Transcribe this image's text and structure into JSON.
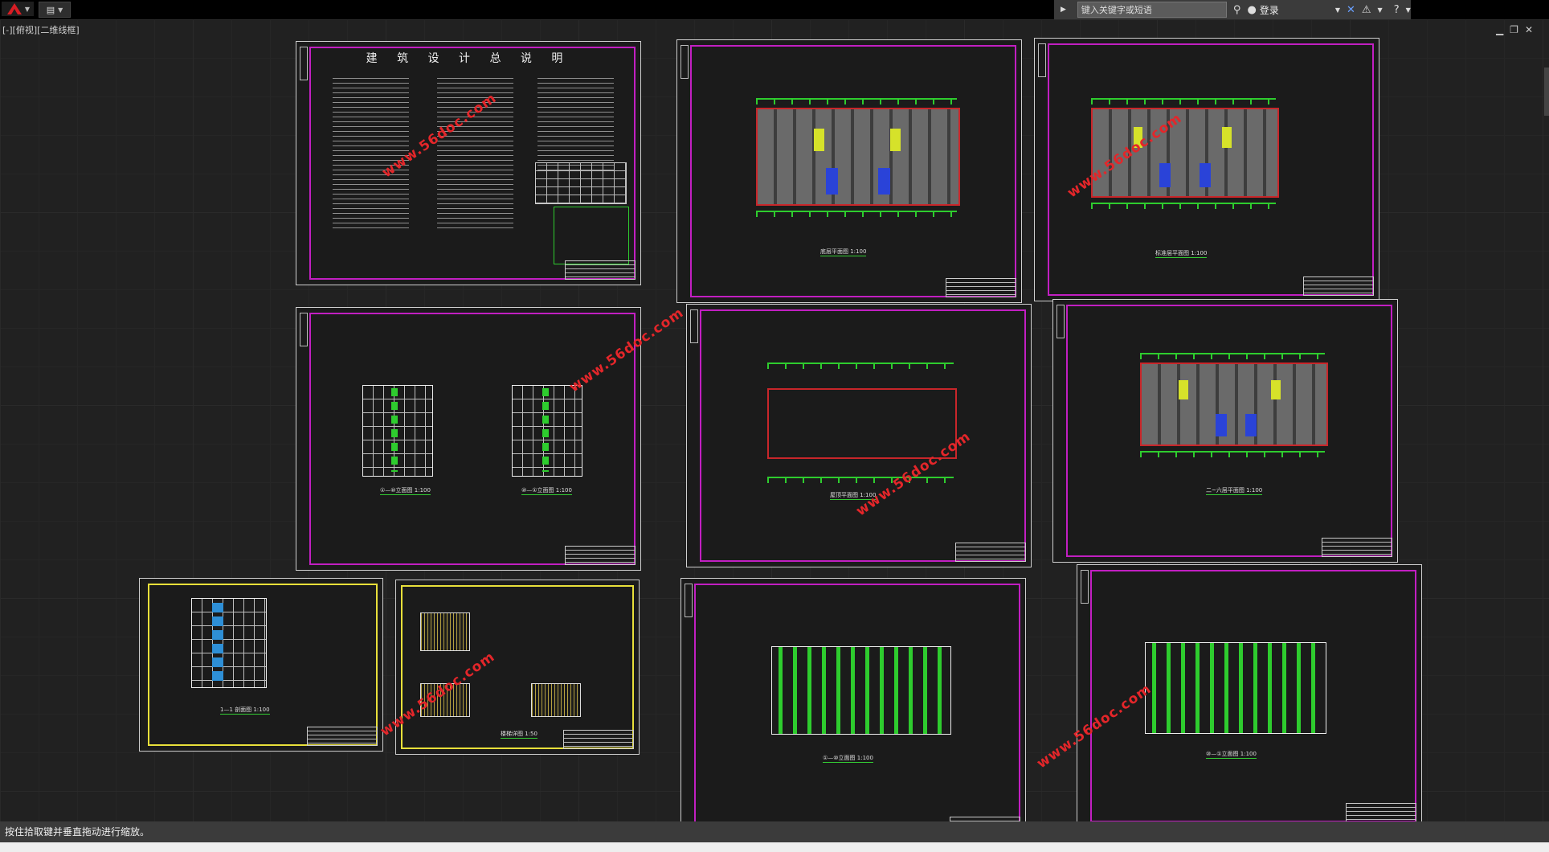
{
  "topbar": {
    "search_placeholder": "键入关键字或短语",
    "login_label": "登录"
  },
  "viewport_label": "[-][俯视][二维线框]",
  "sheets": {
    "design_notes_title": "建 筑 设 计 总 说 明",
    "plan1_caption": "底层平面图 1:100",
    "plan2_caption": "标准层平面图 1:100",
    "side_elev1_caption": "①—⑩立面图 1:100",
    "side_elev2_caption": "⑩—①立面图 1:100",
    "roof_caption": "屋顶平面图 1:100",
    "plan3_caption": "二~六层平面图 1:100",
    "section_caption": "1—1 剖面图 1:100",
    "stair_caption": "楼梯详图 1:50",
    "front_elev_caption": "①—⑩立面图 1:100",
    "back_elev_caption": "⑩—①立面图 1:100"
  },
  "watermark_text": "www.56doc.com",
  "status_text": "按住拾取键并垂直拖动进行缩放。",
  "colors": {
    "background": "#212121",
    "frame": "#c21fc2",
    "grid_line": "#2ecc2e",
    "wall": "#c8262a",
    "watermark": "#e4262a"
  }
}
